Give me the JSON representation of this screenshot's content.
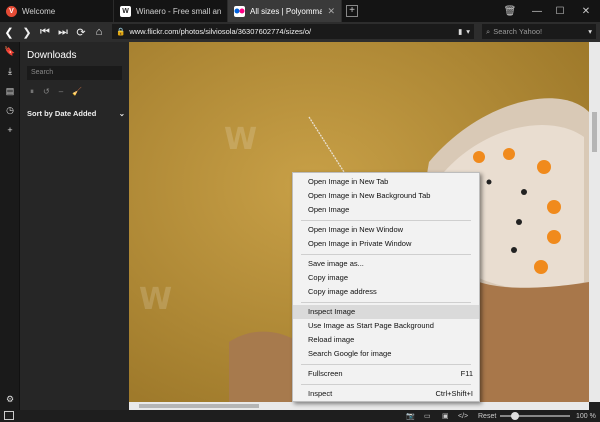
{
  "tabs": [
    {
      "title": "Welcome",
      "favicon": "vivaldi-icon",
      "active": false
    },
    {
      "title": "Winaero - Free small and us",
      "favicon": "winaero-icon",
      "active": false
    },
    {
      "title": "All sizes | Polyommatus icar",
      "favicon": "flickr-icon",
      "active": true
    }
  ],
  "address": {
    "url": "www.flickr.com/photos/silviosola/36307602774/sizes/o/"
  },
  "search": {
    "placeholder": "Search Yahoo!"
  },
  "panel": {
    "title": "Downloads",
    "search_placeholder": "Search",
    "sort_label": "Sort by Date Added"
  },
  "context_menu": {
    "groups": [
      [
        "Open Image in New Tab",
        "Open Image in New Background Tab",
        "Open Image"
      ],
      [
        "Open Image in New Window",
        "Open Image in Private Window"
      ],
      [
        "Save image as...",
        "Copy image",
        "Copy image address"
      ],
      [
        "Inspect Image",
        "Use Image as Start Page Background",
        "Reload image",
        "Search Google for image"
      ],
      [
        "Fullscreen"
      ],
      [
        "Inspect"
      ]
    ],
    "fullscreen_shortcut": "F11",
    "inspect_shortcut": "Ctrl+Shift+I",
    "highlighted": "Inspect Image"
  },
  "statusbar": {
    "reset_label": "Reset",
    "zoom": "100 %"
  },
  "colors": {
    "background": "#1e1e1e",
    "image_tone": "#b9903a"
  }
}
